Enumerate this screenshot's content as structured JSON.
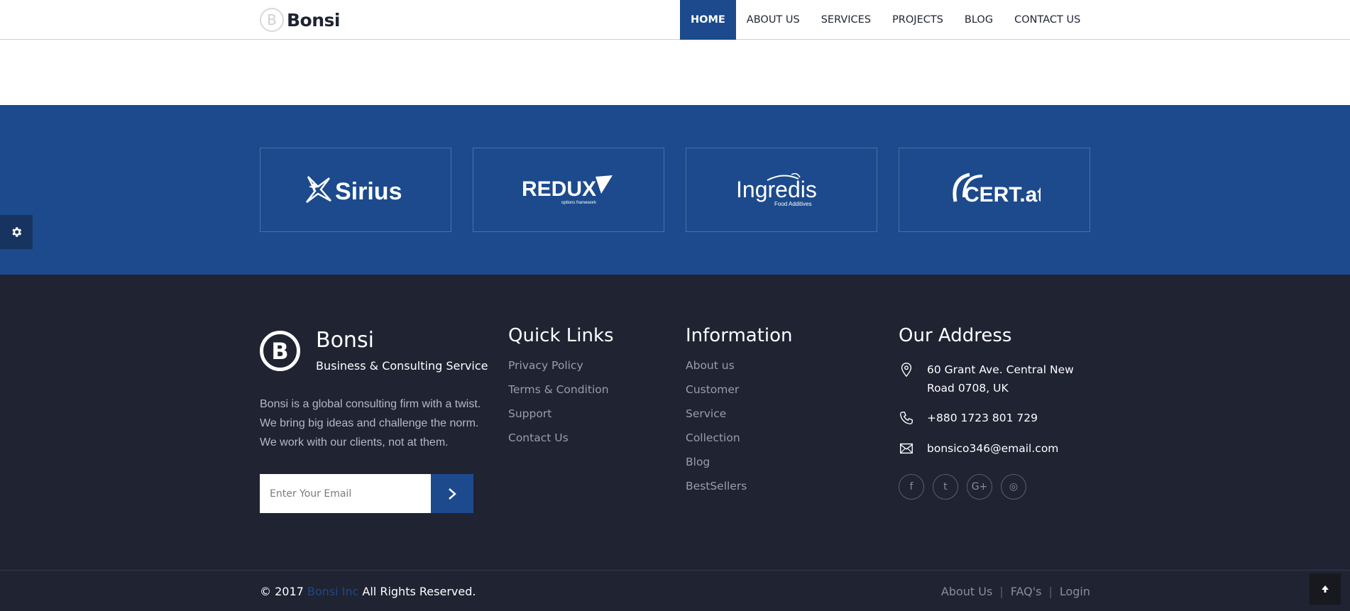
{
  "header": {
    "logo_letter": "B",
    "logo_text": "Bonsi",
    "nav": [
      {
        "label": "HOME",
        "active": true
      },
      {
        "label": "ABOUT US",
        "active": false
      },
      {
        "label": "SERVICES",
        "active": false
      },
      {
        "label": "PROJECTS",
        "active": false
      },
      {
        "label": "BLOG",
        "active": false
      },
      {
        "label": "CONTACT US",
        "active": false
      }
    ]
  },
  "partners": [
    {
      "name": "Sirius",
      "icon": "sirius-star-logo"
    },
    {
      "name": "REDUX",
      "sub": "options framework",
      "icon": "redux-logo"
    },
    {
      "name": "Ingredis",
      "sub": "Food Additives",
      "icon": "ingredis-logo"
    },
    {
      "name": "CERT.at",
      "icon": "cert-at-logo"
    }
  ],
  "settings_icon": "gear-icon",
  "footer": {
    "brand": {
      "letter": "B",
      "name": "Bonsi",
      "tagline": "Business & Consulting Service",
      "description": "Bonsi is a global consulting firm with a twist. We bring big ideas and challenge the norm. We work with our clients, not at them.",
      "email_placeholder": "Enter Your Email"
    },
    "quick_links": {
      "title": "Quick Links",
      "items": [
        "Privacy Policy",
        "Terms & Condition",
        "Support",
        "Contact Us"
      ]
    },
    "information": {
      "title": "Information",
      "items": [
        "About us",
        "Customer",
        "Service",
        "Collection",
        "Blog",
        "BestSellers"
      ]
    },
    "address": {
      "title": "Our Address",
      "line1": "60 Grant Ave. Central New",
      "line2": "Road 0708, UK",
      "phone": "+880 1723 801 729",
      "email": "bonsico346@email.com"
    },
    "socials": [
      {
        "name": "facebook",
        "glyph": "f"
      },
      {
        "name": "twitter",
        "glyph": "t"
      },
      {
        "name": "google-plus",
        "glyph": "G+"
      },
      {
        "name": "dribbble",
        "glyph": "◎"
      }
    ],
    "copyright": {
      "prefix": "© 2017 ",
      "brand": "Bonsi Inc",
      "suffix": " All Rights Reserved."
    },
    "bottom_links": [
      "About Us",
      "FAQ's",
      "Login"
    ]
  },
  "colors": {
    "primary": "#1c4a8c",
    "footer_bg": "#1f2332",
    "text_muted": "#9a9eab"
  }
}
